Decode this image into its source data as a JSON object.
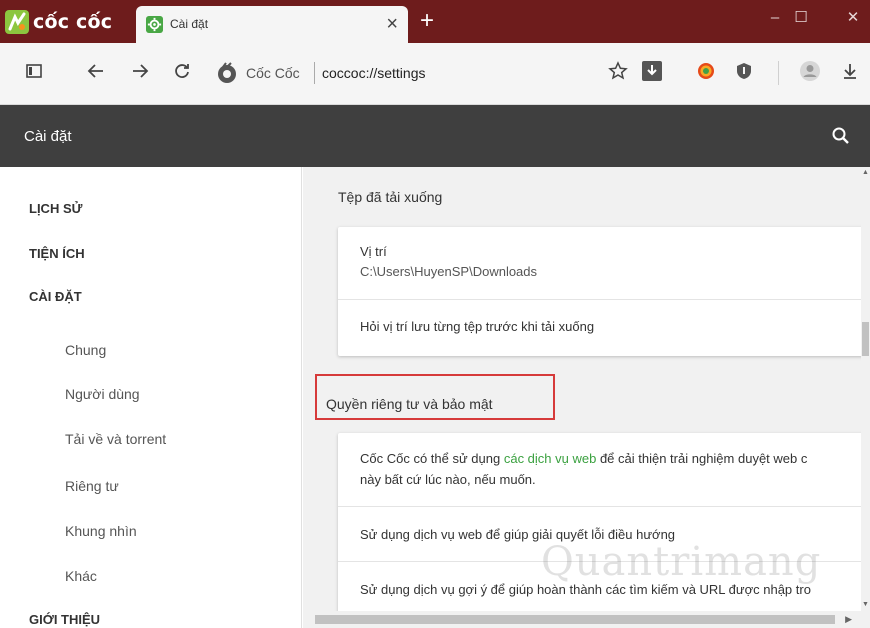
{
  "browser": {
    "brand": "cốc cốc",
    "tab": {
      "title": "Cài đặt",
      "close": "×"
    },
    "new_tab": "+",
    "window": {
      "minimize": "–",
      "maximize": "☐",
      "close": "✕"
    }
  },
  "toolbar": {
    "site_name": "Cốc Cốc",
    "url": "coccoc://settings"
  },
  "settings_header": {
    "title": "Cài đặt"
  },
  "sidebar": {
    "items": [
      {
        "label": "LỊCH SỬ",
        "level": "head"
      },
      {
        "label": "TIỆN ÍCH",
        "level": "head"
      },
      {
        "label": "CÀI ĐẶT",
        "level": "head"
      },
      {
        "label": "Chung",
        "level": "sub"
      },
      {
        "label": "Người dùng",
        "level": "sub"
      },
      {
        "label": "Tải về và torrent",
        "level": "sub"
      },
      {
        "label": "Riêng tư",
        "level": "sub"
      },
      {
        "label": "Khung nhìn",
        "level": "sub"
      },
      {
        "label": "Khác",
        "level": "sub"
      },
      {
        "label": "GIỚI THIỆU",
        "level": "head"
      }
    ]
  },
  "downloads_section": {
    "title": "Tệp đã tải xuống",
    "location_label": "Vị trí",
    "location_value": "C:\\Users\\HuyenSP\\Downloads",
    "ask_label": "Hỏi vị trí lưu từng tệp trước khi tải xuống"
  },
  "privacy_section": {
    "title": "Quyền riêng tư và bảo mật",
    "intro_before_link": "Cốc Cốc có thể sử dụng ",
    "intro_link": "các dịch vụ web",
    "intro_after_link": " để cải thiện trải nghiệm duyệt web c",
    "intro_line2": "này bất cứ lúc nào, nếu muốn.",
    "nav_errors": "Sử dụng dịch vụ web để giúp giải quyết lỗi điều hướng",
    "suggestions": "Sử dụng dịch vụ gợi ý để giúp hoàn thành các tìm kiếm và URL được nhập tro"
  },
  "watermark": "Quantrimang",
  "colors": {
    "title_bar": "#6e1c1c",
    "toolbar": "#f5f5f5",
    "settings_header": "#3f3f3f",
    "content_bg": "#f1f1f1",
    "link": "#3ba140",
    "highlight": "#d63a3a"
  }
}
